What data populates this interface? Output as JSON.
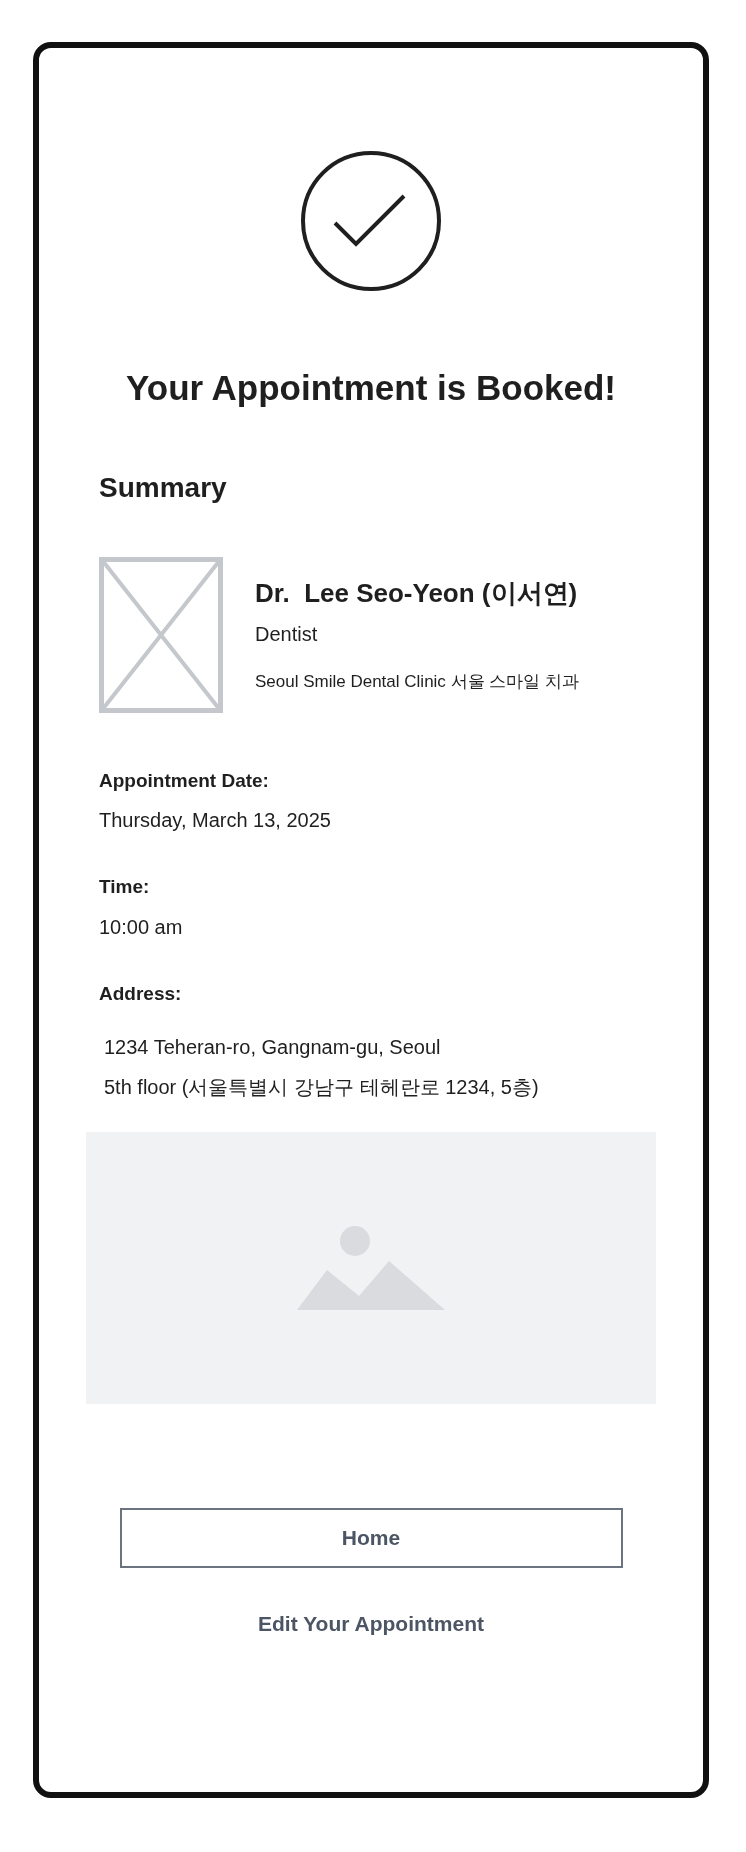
{
  "title": "Your Appointment is Booked!",
  "summary": {
    "heading": "Summary",
    "doctor": {
      "name": "Dr.  Lee Seo-Yeon (이서연)",
      "specialty": "Dentist",
      "clinic": "Seoul Smile Dental Clinic 서울 스마일 치과"
    },
    "details": [
      {
        "label": "Appointment Date:",
        "lines": [
          "Thursday, March 13, 2025"
        ]
      },
      {
        "label": "Time:",
        "lines": [
          "10:00 am"
        ]
      },
      {
        "label": "Address:",
        "lines": [
          "1234 Teheran-ro, Gangnam-gu, Seoul",
          "5th floor (서울특별시 강남구 테헤란로 1234, 5층)"
        ]
      }
    ]
  },
  "buttons": [
    {
      "label": "Home",
      "kind": "outlined"
    },
    {
      "label": "Edit Your Appointment",
      "kind": "link"
    }
  ]
}
